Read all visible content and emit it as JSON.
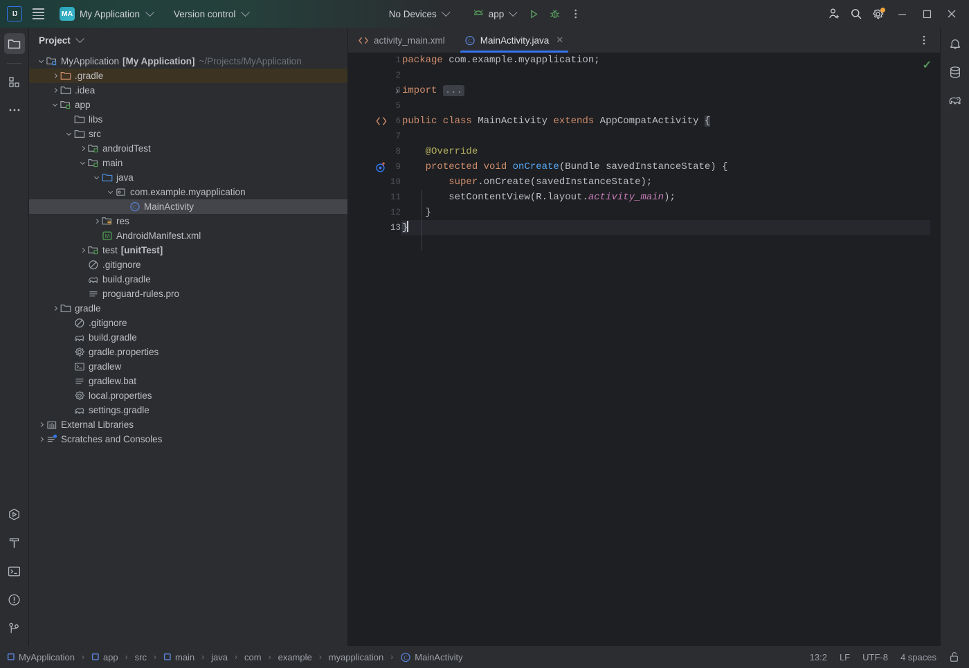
{
  "toolbar": {
    "logo": "IJ",
    "menu_icon": "hamburger-menu-icon",
    "project_badge": "MA",
    "project_name": "My Application",
    "version_control": "Version control",
    "device_selector": "No Devices",
    "run_config": "app",
    "run_icon": "run-play-icon",
    "debug_icon": "debug-bug-icon",
    "more_icon": "more-vertical-icon",
    "account_icon": "user-add-icon",
    "search_icon": "search-icon",
    "settings_icon": "gear-icon",
    "minimize": "minimize-icon",
    "maximize": "maximize-icon",
    "close": "close-icon"
  },
  "left_stripe": {
    "top": [
      {
        "name": "project-tool-window",
        "icon": "folder-icon",
        "active": true
      },
      {
        "name": "structure-tool-window",
        "icon": "blocks-icon",
        "active": false
      },
      {
        "name": "more-tool-windows",
        "icon": "ellipsis-icon",
        "active": false
      }
    ],
    "bottom": [
      {
        "name": "run-tool-window",
        "icon": "run-hexagon-icon"
      },
      {
        "name": "build-tool-window",
        "icon": "hammer-icon"
      },
      {
        "name": "terminal-tool-window",
        "icon": "terminal-icon"
      },
      {
        "name": "problems-tool-window",
        "icon": "warning-circle-icon"
      },
      {
        "name": "version-control-tool-window",
        "icon": "git-branch-icon"
      }
    ]
  },
  "right_stripe": [
    {
      "name": "notifications",
      "icon": "bell-icon"
    },
    {
      "name": "database",
      "icon": "database-icon"
    },
    {
      "name": "gradle",
      "icon": "gradle-elephant-icon"
    }
  ],
  "project_panel": {
    "title": "Project",
    "tree": [
      {
        "depth": 0,
        "arrow": "down",
        "icon": "module-folder-blue",
        "label": "MyApplication",
        "bold_suffix": "[My Application]",
        "path": "~/Projects/MyApplication",
        "state": "normal"
      },
      {
        "depth": 1,
        "arrow": "right",
        "icon": "folder-orange",
        "label": ".gradle",
        "state": "highlight"
      },
      {
        "depth": 1,
        "arrow": "right",
        "icon": "folder-gray",
        "label": ".idea",
        "state": "normal"
      },
      {
        "depth": 1,
        "arrow": "down",
        "icon": "module-folder-green",
        "label": "app",
        "state": "normal"
      },
      {
        "depth": 2,
        "arrow": "none",
        "icon": "folder-gray",
        "label": "libs",
        "state": "normal"
      },
      {
        "depth": 2,
        "arrow": "down",
        "icon": "folder-gray",
        "label": "src",
        "state": "normal"
      },
      {
        "depth": 3,
        "arrow": "right",
        "icon": "module-folder-green",
        "label": "androidTest",
        "state": "normal"
      },
      {
        "depth": 3,
        "arrow": "down",
        "icon": "module-folder-green",
        "label": "main",
        "state": "normal"
      },
      {
        "depth": 4,
        "arrow": "down",
        "icon": "folder-blue",
        "label": "java",
        "state": "normal"
      },
      {
        "depth": 5,
        "arrow": "down",
        "icon": "package-icon",
        "label": "com.example.myapplication",
        "state": "normal"
      },
      {
        "depth": 6,
        "arrow": "none",
        "icon": "java-class-icon",
        "label": "MainActivity",
        "state": "selected"
      },
      {
        "depth": 4,
        "arrow": "right",
        "icon": "res-folder-icon",
        "label": "res",
        "state": "normal"
      },
      {
        "depth": 4,
        "arrow": "none",
        "icon": "manifest-icon",
        "label": "AndroidManifest.xml",
        "state": "normal"
      },
      {
        "depth": 3,
        "arrow": "right",
        "icon": "module-folder-green",
        "label": "test",
        "bold_suffix": "[unitTest]",
        "state": "normal"
      },
      {
        "depth": 3,
        "arrow": "none",
        "icon": "gitignore-icon",
        "label": ".gitignore",
        "state": "normal"
      },
      {
        "depth": 3,
        "arrow": "none",
        "icon": "gradle-file-icon",
        "label": "build.gradle",
        "state": "normal"
      },
      {
        "depth": 3,
        "arrow": "none",
        "icon": "text-file-icon",
        "label": "proguard-rules.pro",
        "state": "normal"
      },
      {
        "depth": 1,
        "arrow": "right",
        "icon": "folder-gray",
        "label": "gradle",
        "state": "normal"
      },
      {
        "depth": 2,
        "arrow": "none",
        "icon": "gitignore-icon",
        "label": ".gitignore",
        "state": "normal"
      },
      {
        "depth": 2,
        "arrow": "none",
        "icon": "gradle-file-icon",
        "label": "build.gradle",
        "state": "normal"
      },
      {
        "depth": 2,
        "arrow": "none",
        "icon": "properties-icon",
        "label": "gradle.properties",
        "state": "normal"
      },
      {
        "depth": 2,
        "arrow": "none",
        "icon": "shell-script-icon",
        "label": "gradlew",
        "state": "normal"
      },
      {
        "depth": 2,
        "arrow": "none",
        "icon": "text-file-icon",
        "label": "gradlew.bat",
        "state": "normal"
      },
      {
        "depth": 2,
        "arrow": "none",
        "icon": "properties-icon",
        "label": "local.properties",
        "state": "normal"
      },
      {
        "depth": 2,
        "arrow": "none",
        "icon": "gradle-file-icon",
        "label": "settings.gradle",
        "state": "normal"
      },
      {
        "depth": 0,
        "arrow": "right",
        "icon": "library-icon",
        "label": "External Libraries",
        "state": "normal"
      },
      {
        "depth": 0,
        "arrow": "right",
        "icon": "scratches-icon",
        "label": "Scratches and Consoles",
        "state": "normal"
      }
    ]
  },
  "editor": {
    "tabs": [
      {
        "label": "activity_main.xml",
        "icon": "xml-layout-icon",
        "active": false,
        "closable": false
      },
      {
        "label": "MainActivity.java",
        "icon": "java-class-icon",
        "active": true,
        "closable": true
      }
    ],
    "tab_options_icon": "more-vertical-icon",
    "inspection_status": "✓",
    "close_glyph": "✕",
    "lines": [
      {
        "num": "1",
        "current": false,
        "gutter": "",
        "fold": false,
        "tokens": [
          {
            "t": "package",
            "c": "kw"
          },
          {
            "t": " com.example.myapplication;",
            "c": "txt"
          }
        ]
      },
      {
        "num": "2",
        "current": false,
        "gutter": "",
        "fold": false,
        "tokens": []
      },
      {
        "num": "3",
        "current": false,
        "gutter": "",
        "fold": true,
        "tokens": [
          {
            "t": "import",
            "c": "kw"
          },
          {
            "t": " ",
            "c": "txt"
          },
          {
            "t": "...",
            "c": "chip"
          }
        ]
      },
      {
        "num": "5",
        "current": false,
        "gutter": "",
        "fold": false,
        "tokens": []
      },
      {
        "num": "6",
        "current": false,
        "gutter": "code-tag-icon",
        "fold": false,
        "tokens": [
          {
            "t": "public class",
            "c": "kw"
          },
          {
            "t": " MainActivity ",
            "c": "txt"
          },
          {
            "t": "extends",
            "c": "kw"
          },
          {
            "t": " AppCompatActivity ",
            "c": "txt"
          },
          {
            "t": "{",
            "c": "selbrace"
          }
        ]
      },
      {
        "num": "7",
        "current": false,
        "gutter": "",
        "fold": false,
        "tokens": []
      },
      {
        "num": "8",
        "current": false,
        "gutter": "",
        "fold": false,
        "tokens": [
          {
            "t": "    ",
            "c": "txt"
          },
          {
            "t": "@Override",
            "c": "anno"
          }
        ]
      },
      {
        "num": "9",
        "current": false,
        "gutter": "override-method-icon",
        "fold": false,
        "tokens": [
          {
            "t": "    ",
            "c": "txt"
          },
          {
            "t": "protected void",
            "c": "kw"
          },
          {
            "t": " ",
            "c": "txt"
          },
          {
            "t": "onCreate",
            "c": "fn"
          },
          {
            "t": "(Bundle savedInstanceState) {",
            "c": "txt"
          }
        ]
      },
      {
        "num": "10",
        "current": false,
        "gutter": "",
        "fold": false,
        "tokens": [
          {
            "t": "        ",
            "c": "txt"
          },
          {
            "t": "super",
            "c": "kw"
          },
          {
            "t": ".onCreate(savedInstanceState);",
            "c": "txt"
          }
        ]
      },
      {
        "num": "11",
        "current": false,
        "gutter": "",
        "fold": false,
        "tokens": [
          {
            "t": "        setContentView(R.layout.",
            "c": "txt"
          },
          {
            "t": "activity_main",
            "c": "field"
          },
          {
            "t": ");",
            "c": "txt"
          }
        ]
      },
      {
        "num": "12",
        "current": false,
        "gutter": "",
        "fold": false,
        "tokens": [
          {
            "t": "    }",
            "c": "txt"
          }
        ]
      },
      {
        "num": "13",
        "current": true,
        "gutter": "",
        "fold": false,
        "tokens": [
          {
            "t": "}",
            "c": "selbrace"
          },
          {
            "t": "",
            "c": "caret"
          }
        ]
      }
    ]
  },
  "status_bar": {
    "breadcrumbs": [
      {
        "label": "MyApplication",
        "icon": "module-square-icon"
      },
      {
        "label": "app",
        "icon": "module-square-icon"
      },
      {
        "label": "src",
        "icon": "none"
      },
      {
        "label": "main",
        "icon": "module-square-icon"
      },
      {
        "label": "java",
        "icon": "none"
      },
      {
        "label": "com",
        "icon": "none"
      },
      {
        "label": "example",
        "icon": "none"
      },
      {
        "label": "myapplication",
        "icon": "none"
      },
      {
        "label": "MainActivity",
        "icon": "java-class-icon"
      }
    ],
    "separator": "›",
    "caret_position": "13:2",
    "line_separator": "LF",
    "encoding": "UTF-8",
    "indent": "4 spaces",
    "lock_icon": "unlocked-padlock-icon"
  },
  "colors": {
    "accent_blue": "#3574f0",
    "bg_panel": "#2b2d30",
    "bg_editor": "#1e1f22",
    "selection": "#43454a",
    "highlight_row": "#3d3322",
    "keyword_orange": "#cf8e6d",
    "method_blue": "#56a8f5",
    "annotation_yellow": "#b3ae60",
    "field_purple": "#c77dbb",
    "success_green": "#57965c"
  }
}
